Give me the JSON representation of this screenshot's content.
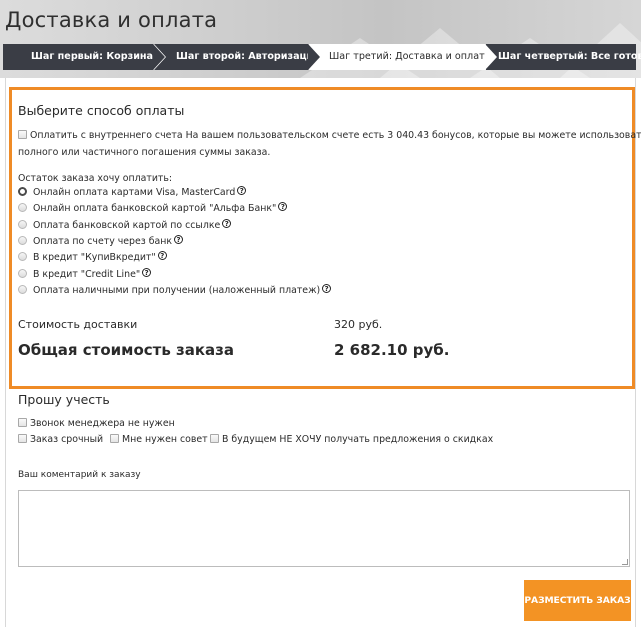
{
  "page": {
    "title": "Доставка и оплата"
  },
  "steps": [
    {
      "label": "Шаг первый: Корзина"
    },
    {
      "label": "Шаг второй: Авторизация"
    },
    {
      "label": "Шаг третий: Доставка и оплата"
    },
    {
      "label": "Шаг четвертый: Все готово!"
    }
  ],
  "payment": {
    "title": "Выберите способ оплаты",
    "bonus_label_line1": "Оплатить с внутреннего счета На вашем пользовательском счете есть 3 040.43 бонусов, которые вы можете использовать для",
    "bonus_label_line2": "полного или частичного погашения суммы заказа.",
    "remaining_label": "Остаток заказа хочу оплатить:",
    "options": [
      {
        "label": "Онлайн оплата картами Visa, MasterCard",
        "checked": true
      },
      {
        "label": "Онлайн оплата банковской картой \"Альфа Банк\"",
        "checked": false
      },
      {
        "label": "Оплата банковской картой по ссылке",
        "checked": false
      },
      {
        "label": "Оплата по счету через банк",
        "checked": false
      },
      {
        "label": "В кредит \"КупиВкредит\"",
        "checked": false
      },
      {
        "label": "В кредит \"Credit Line\"",
        "checked": false
      },
      {
        "label": "Оплата наличными при получении (наложенный платеж)",
        "checked": false
      }
    ],
    "help_glyph": "?"
  },
  "totals": {
    "delivery_label": "Стоимость доставки",
    "delivery_value": "320 руб.",
    "total_label": "Общая стоимость заказа",
    "total_value": "2 682.10 руб."
  },
  "requests": {
    "title": "Прошу учесть",
    "no_call": "Звонок менеджера не нужен",
    "urgent": "Заказ срочный",
    "advice": "Мне нужен совет",
    "no_offers": "В будущем НЕ ХОЧУ получать предложения о скидках"
  },
  "comment": {
    "label": "Ваш коментарий к заказу",
    "value": ""
  },
  "submit": {
    "label": "РАЗМЕСТИТЬ ЗАКАЗ"
  },
  "colors": {
    "accent": "#ef8b26",
    "button": "#f39324",
    "step_dark": "#3a3d45"
  }
}
